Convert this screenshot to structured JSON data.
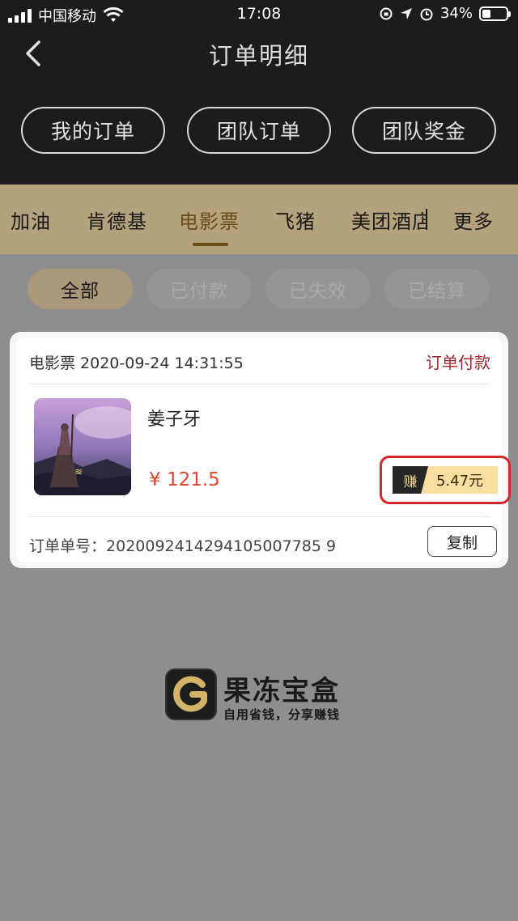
{
  "status_bar": {
    "carrier": "中国移动",
    "time": "17:08",
    "battery_percent": "34%",
    "battery_level": 0.34
  },
  "nav": {
    "title": "订单明细",
    "back_icon": "chevron-left-icon",
    "segments": [
      "我的订单",
      "团队订单",
      "团队奖金"
    ],
    "active_segment": 0
  },
  "categories": {
    "items": [
      "加油",
      "肯德基",
      "电影票",
      "飞猪",
      "美团酒店",
      "更多"
    ],
    "active": 2
  },
  "filters": {
    "items": [
      "全部",
      "已付款",
      "已失效",
      "已结算"
    ],
    "active": 0
  },
  "order": {
    "header": "电影票 2020-09-24 14:31:55",
    "status": "订单付款",
    "movie_title": "姜子牙",
    "price": "¥ 121.5",
    "earn_tag": "赚",
    "earn_amount": "5.47元",
    "order_number_label": "订单单号：",
    "order_number": "2020092414294105007785 9",
    "copy_label": "复制",
    "colors": {
      "status": "#a3262a",
      "price": "#e0452d",
      "highlight_outline": "#d42626"
    }
  },
  "watermark": {
    "title": "果冻宝盒",
    "subtitle": "自用省钱，分享赚钱"
  }
}
